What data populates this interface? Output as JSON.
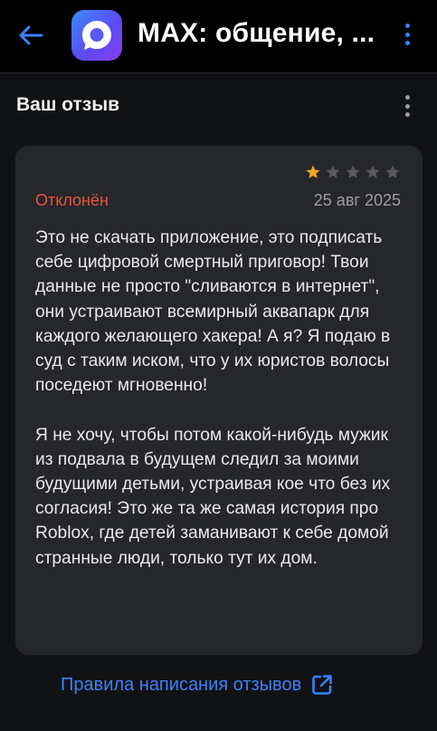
{
  "header": {
    "app_title": "MAX: общение, ...",
    "back_icon": "arrow-left-icon",
    "app_icon": "max-app-logo",
    "menu_icon": "more-vertical-icon",
    "accent_color": "#3b82ff"
  },
  "subheader": {
    "title": "Ваш отзыв",
    "menu_icon": "more-vertical-icon"
  },
  "review": {
    "rating": 1,
    "rating_max": 5,
    "status": "Отклонён",
    "status_color": "#e8543e",
    "date": "25 авг 2025",
    "text": "Это не скачать приложение, это подписать себе цифровой смертный приговор! Твои данные не просто \"сливаются в интернет\", они устраивают всемирный аквапарк для каждого желающего хакера! А я? Я подаю в суд с таким иском, что у их юристов волосы поседеют мгновенно!\n\nЯ не хочу, чтобы потом какой-нибудь мужик из подвала в будущем следил за моими будущими детьми, устраивая кое что без их согласия! Это же та же самая история про Roblox, где детей заманивают к себе домой странные люди, только тут их дом."
  },
  "footer": {
    "rules_link": "Правила написания отзывов",
    "link_icon": "open-in-new-icon"
  }
}
